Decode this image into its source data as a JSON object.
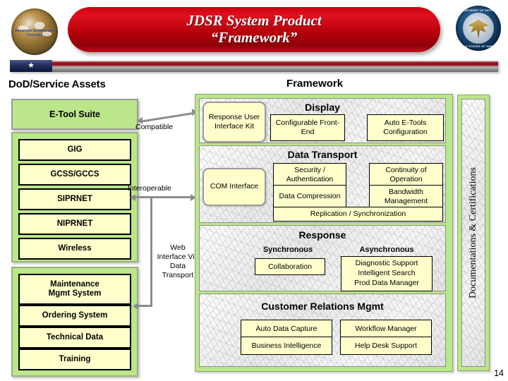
{
  "header": {
    "title_line1": "JDSR System Product",
    "title_line2": "“Framework”",
    "left_seal_text": "Advanced Systems and Concepts",
    "right_seal_top": "DEPARTMENT OF DEFENSE",
    "right_seal_bottom": "UNITED STATES OF AMERICA",
    "star_glyph": "★"
  },
  "left_column": {
    "heading": "DoD/Service Assets",
    "etool_suite": "E-Tool Suite",
    "assets": [
      "GIG",
      "GCSS/GCCS",
      "SIPRNET",
      "NIPRNET",
      "Wireless"
    ],
    "systems": [
      "Maintenance\nMgmt System",
      "Ordering System",
      "Technical Data",
      "Training"
    ]
  },
  "connectors": {
    "compatible": "Compatible",
    "interoperable": "Interoperable",
    "web_interface": "Web Interface Via Data Transport"
  },
  "framework": {
    "heading": "Framework",
    "display": {
      "title": "Display",
      "entry_box": "Response User Interface Kit",
      "items": [
        "Configurable Front-End",
        "Auto E-Tools Configuration"
      ]
    },
    "data_transport": {
      "title": "Data Transport",
      "entry_box": "COM Interface",
      "left_items": [
        "Security / Authentication",
        "Data Compression"
      ],
      "right_items": [
        "Continuity of Operation",
        "Bandwidth Management"
      ],
      "full_item": "Replication / Synchronization"
    },
    "response": {
      "title": "Response",
      "synchronous_label": "Synchronous",
      "asynchronous_label": "Asynchronous",
      "synchronous_items": [
        "Collaboration"
      ],
      "asynchronous_items": [
        "Diagnostic Support",
        "Intelligent Search",
        "Prod Data Manager"
      ]
    },
    "crm": {
      "title": "Customer Relations Mgmt",
      "left_items": [
        "Auto Data Capture",
        "Business Intelligence"
      ],
      "right_items": [
        "Workflow Manager",
        "Help Desk Support"
      ]
    }
  },
  "right_panel": {
    "label": "Documentations & Certifications"
  },
  "footer": {
    "page_number": "14"
  },
  "colors": {
    "banner_red": "#c0101c",
    "group_green": "#bbe68a",
    "box_yellow": "#ffffcc",
    "connector_gray": "#8c8c8c"
  }
}
